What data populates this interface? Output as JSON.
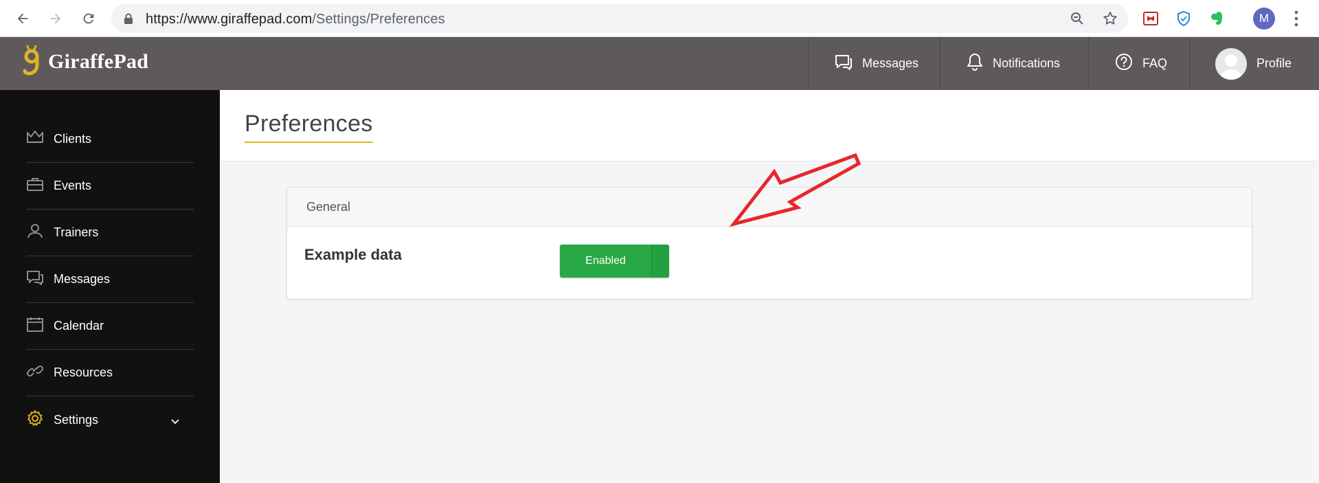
{
  "browser": {
    "url_host": "https://www.giraffepad.com",
    "url_path": "/Settings/Preferences",
    "profile_initial": "M"
  },
  "header": {
    "app_name": "GiraffePad",
    "messages_label": "Messages",
    "notifications_label": "Notifications",
    "faq_label": "FAQ",
    "profile_label": "Profile"
  },
  "sidebar": {
    "items": [
      {
        "label": "Clients",
        "icon": "crown-icon"
      },
      {
        "label": "Events",
        "icon": "briefcase-icon"
      },
      {
        "label": "Trainers",
        "icon": "user-icon"
      },
      {
        "label": "Messages",
        "icon": "chat-icon"
      },
      {
        "label": "Calendar",
        "icon": "calendar-icon"
      },
      {
        "label": "Resources",
        "icon": "link-icon"
      },
      {
        "label": "Settings",
        "icon": "gear-icon"
      }
    ]
  },
  "main": {
    "page_title": "Preferences",
    "card_title": "General",
    "rows": [
      {
        "label": "Example data",
        "toggle_label": "Enabled"
      }
    ]
  },
  "colors": {
    "header_bg": "#5e5a5b",
    "sidebar_bg": "#111111",
    "accent": "#e0b423",
    "toggle_green": "#27a844",
    "annotation_red": "#e8262b"
  }
}
